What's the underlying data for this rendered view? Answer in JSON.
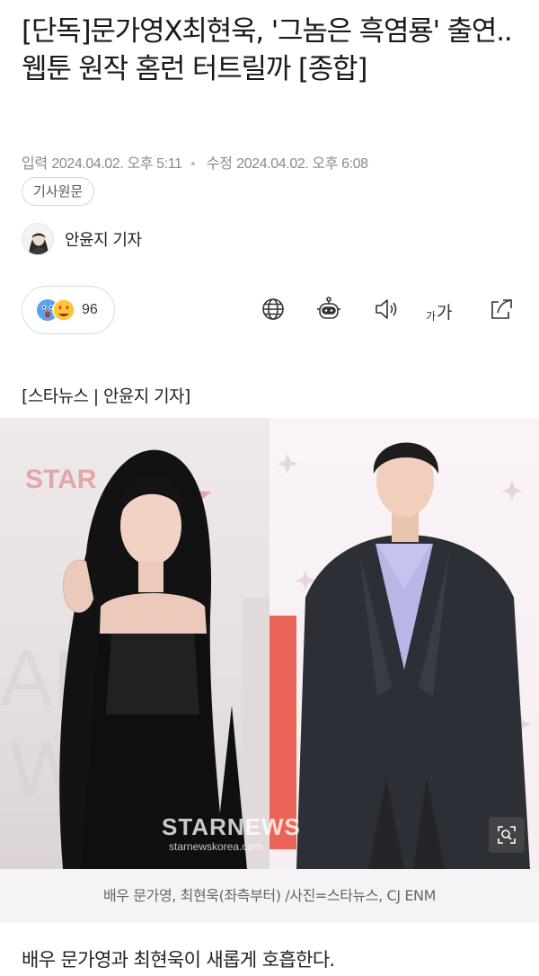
{
  "article": {
    "title": "[단독]문가영X최현욱, '그놈은 흑염룡' 출연..웹툰 원작 홈런 터트릴까 [종합]",
    "published_label": "입력",
    "published_time": "2024.04.02. 오후 5:11",
    "modified_label": "수정",
    "modified_time": "2024.04.02. 오후 6:08",
    "original_button": "기사원문",
    "author": "안윤지 기자",
    "source_line": "[스타뉴스 | 안윤지 기자]",
    "image_caption": "배우 문가영, 최현욱(좌측부터) /사진=스타뉴스, CJ ENM",
    "image_watermark": "STARNEWS",
    "image_watermark_url": "starnewskorea.com",
    "image_backdrop_left": "STAR",
    "body_first_line": "배우 문가영과 최현욱이 새롭게 호흡한다."
  },
  "reaction": {
    "count": "96"
  },
  "toolbar": {
    "icons": [
      "globe-icon",
      "robot-summary-icon",
      "speaker-icon",
      "font-size-icon",
      "share-icon"
    ],
    "font_small": "가",
    "font_large": "가"
  },
  "colors": {
    "accent": "#e6534d",
    "text": "#1a1a1a",
    "meta": "#8a8a8a"
  }
}
